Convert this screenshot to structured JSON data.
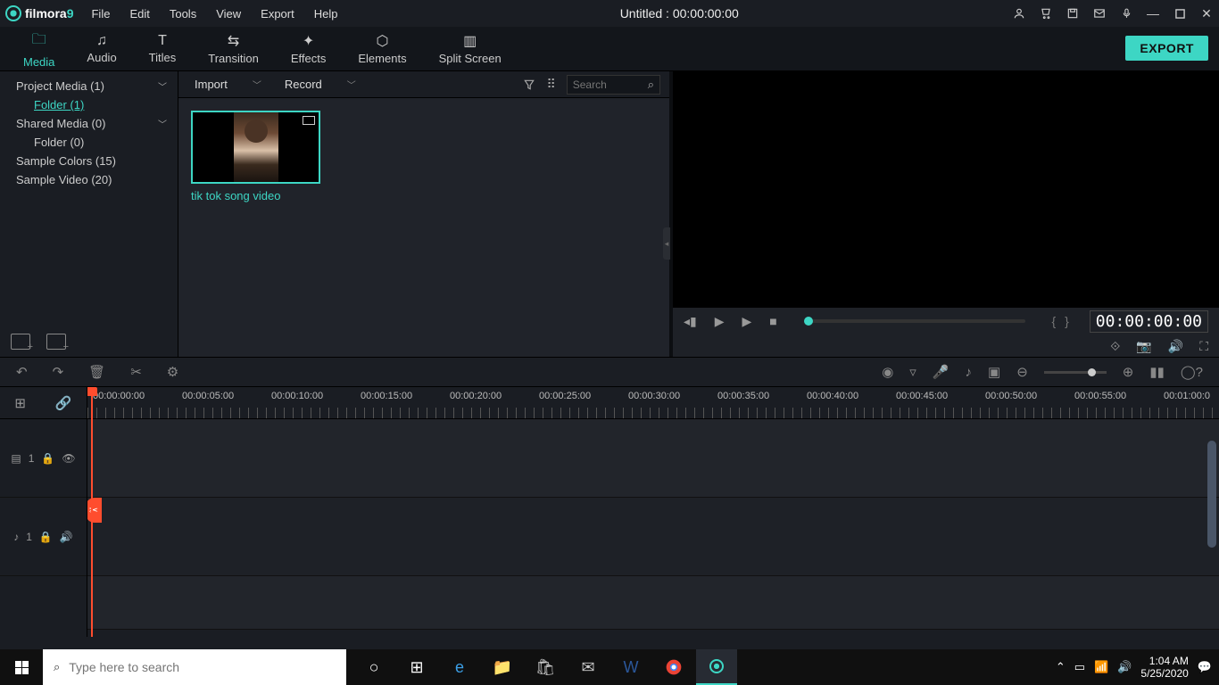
{
  "app": {
    "name": "filmora",
    "version": "9",
    "title": "Untitled : 00:00:00:00"
  },
  "menu": [
    "File",
    "Edit",
    "Tools",
    "View",
    "Export",
    "Help"
  ],
  "tabs": [
    {
      "label": "Media",
      "active": true
    },
    {
      "label": "Audio"
    },
    {
      "label": "Titles"
    },
    {
      "label": "Transition"
    },
    {
      "label": "Effects"
    },
    {
      "label": "Elements"
    },
    {
      "label": "Split Screen"
    }
  ],
  "export_label": "EXPORT",
  "tree": [
    {
      "label": "Project Media (1)",
      "chev": true
    },
    {
      "label": "Folder (1)",
      "child": true,
      "sel": true
    },
    {
      "label": "Shared Media (0)",
      "chev": true
    },
    {
      "label": "Folder (0)",
      "child": true
    },
    {
      "label": "Sample Colors (15)"
    },
    {
      "label": "Sample Video (20)"
    }
  ],
  "mid": {
    "import": "Import",
    "record": "Record",
    "search_ph": "Search"
  },
  "clip": {
    "name": "tik tok song video"
  },
  "preview": {
    "time": "00:00:00:00"
  },
  "ruler": [
    "00:00:00:00",
    "00:00:05:00",
    "00:00:10:00",
    "00:00:15:00",
    "00:00:20:00",
    "00:00:25:00",
    "00:00:30:00",
    "00:00:35:00",
    "00:00:40:00",
    "00:00:45:00",
    "00:00:50:00",
    "00:00:55:00",
    "00:01:00:0"
  ],
  "track": {
    "video": "1",
    "audio": "1"
  },
  "taskbar": {
    "search_ph": "Type here to search",
    "time": "1:04 AM",
    "date": "5/25/2020"
  }
}
